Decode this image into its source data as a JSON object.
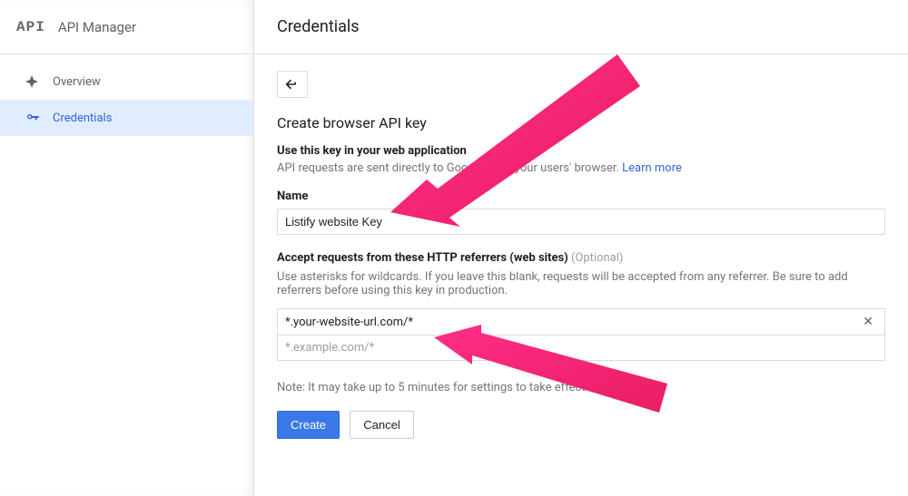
{
  "sidebar": {
    "logo": "API",
    "title": "API Manager",
    "items": [
      {
        "label": "Overview"
      },
      {
        "label": "Credentials"
      }
    ]
  },
  "header": {
    "title": "Credentials"
  },
  "section": {
    "title": "Create browser API key",
    "subtitle_bold": "Use this key in your web application",
    "subtitle_desc": "API requests are sent directly to Google from your users' browser. ",
    "learn_more": "Learn more"
  },
  "name_field": {
    "label": "Name",
    "value": "Listify website Key"
  },
  "referrers_field": {
    "label": "Accept requests from these HTTP referrers (web sites)",
    "optional": "(Optional)",
    "help": "Use asterisks for wildcards. If you leave this blank, requests will be accepted from any referrer. Be sure to add referrers before using this key in production.",
    "entries": [
      "*.your-website-url.com/*"
    ],
    "placeholder": "*.example.com/*"
  },
  "note": "Note: It may take up to 5 minutes for settings to take effect",
  "buttons": {
    "create": "Create",
    "cancel": "Cancel"
  }
}
